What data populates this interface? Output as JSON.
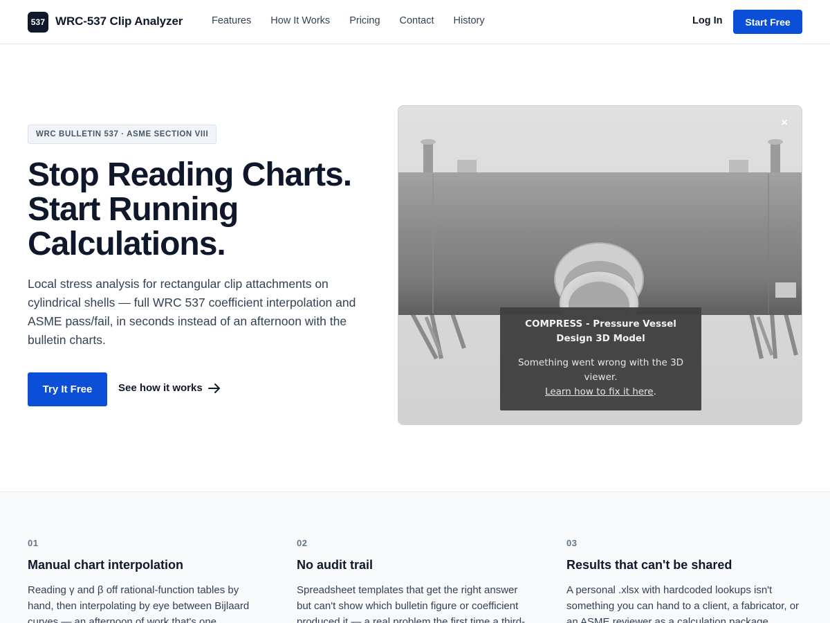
{
  "nav": {
    "logo_text": "537",
    "brand": "WRC-537 Clip Analyzer",
    "links": [
      "Features",
      "How It Works",
      "Pricing",
      "Contact",
      "History"
    ],
    "login": "Log In",
    "cta": "Start Free"
  },
  "hero": {
    "badge": "WRC BULLETIN 537 · ASME SECTION VIII",
    "headline": [
      "Stop Reading Charts.",
      "Start Running",
      "Calculations."
    ],
    "lede": "Local stress analysis for rectangular clip attachments on cylindrical shells — full WRC 537 coefficient interpolation and ASME pass/fail, in seconds instead of an afternoon with the bulletin charts.",
    "primary_button": "Try It Free",
    "secondary_link": "See how it works"
  },
  "viewer": {
    "close_icon": "close-icon",
    "error_title": "COMPRESS - Pressure Vessel Design 3D Model",
    "error_message": "Something went wrong with the 3D viewer.",
    "error_link": "Learn how to fix it here",
    "error_link_suffix": "."
  },
  "features": [
    {
      "num": "01",
      "title": "Manual chart interpolation",
      "body": "Reading γ and β off rational-function tables by hand, then interpolating by eye between Bijlaard curves — an afternoon of work that's one"
    },
    {
      "num": "02",
      "title": "No audit trail",
      "body": "Spreadsheet templates that get the right answer but can't show which bulletin figure or coefficient produced it — a real problem the first time a third-"
    },
    {
      "num": "03",
      "title": "Results that can't be shared",
      "body": "A personal .xlsx with hardcoded lookups isn't something you can hand to a client, a fabricator, or an ASME reviewer as a calculation package."
    }
  ],
  "colors": {
    "primary": "#0b4fd8",
    "ink": "#0f172a",
    "muted": "#334155"
  }
}
